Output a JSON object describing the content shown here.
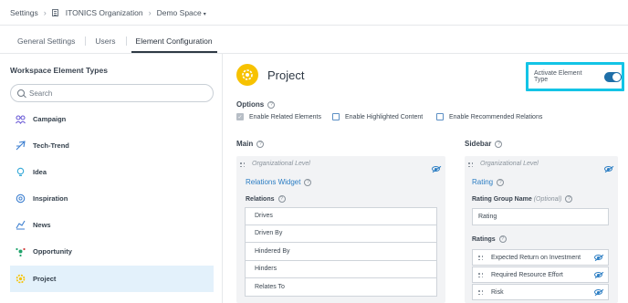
{
  "breadcrumb": {
    "settings": "Settings",
    "separator": "›",
    "organization": "ITONICS Organization",
    "space": "Demo Space",
    "space_caret": "▾"
  },
  "tabs": [
    {
      "label": "General Settings",
      "active": false
    },
    {
      "label": "Users",
      "active": false
    },
    {
      "label": "Element Configuration",
      "active": true
    }
  ],
  "sidebar": {
    "title": "Workspace Element Types",
    "search_placeholder": "Search",
    "items": [
      {
        "label": "Campaign",
        "icon": "campaign-icon",
        "color": "#6b5bd6",
        "active": false
      },
      {
        "label": "Tech-Trend",
        "icon": "tech-trend-icon",
        "color": "#3d7fd0",
        "active": false
      },
      {
        "label": "Idea",
        "icon": "idea-icon",
        "color": "#36a9d8",
        "active": false
      },
      {
        "label": "Inspiration",
        "icon": "inspiration-icon",
        "color": "#3d7fd0",
        "active": false
      },
      {
        "label": "News",
        "icon": "news-icon",
        "color": "#3d7fd0",
        "active": false
      },
      {
        "label": "Opportunity",
        "icon": "opportunity-icon",
        "color": "#20a36b",
        "active": false
      },
      {
        "label": "Project",
        "icon": "project-icon",
        "color": "#f7c200",
        "active": true
      }
    ]
  },
  "element": {
    "title": "Project",
    "accent_color": "#f7c200",
    "activate_label": "Activate Element Type",
    "activate_on": true
  },
  "options": {
    "label": "Options",
    "items": [
      {
        "label": "Enable Related Elements",
        "checked": true
      },
      {
        "label": "Enable Highlighted Content",
        "checked": false
      },
      {
        "label": "Enable Recommended Relations",
        "checked": false
      }
    ]
  },
  "main_section": {
    "label": "Main",
    "org_level": "Organizational Level",
    "widget_title": "Relations Widget",
    "relations_label": "Relations",
    "relations": [
      "Drives",
      "Driven By",
      "Hindered By",
      "Hinders",
      "Relates To"
    ]
  },
  "sidebar_section": {
    "label": "Sidebar",
    "org_level": "Organizational Level",
    "widget_title": "Rating",
    "group_name_label": "Rating Group Name",
    "group_name_optional": "(Optional)",
    "group_name_value": "Rating",
    "ratings_label": "Ratings",
    "ratings": [
      "Expected Return on Investment",
      "Required Resource Effort",
      "Risk"
    ]
  },
  "help_glyph": "?"
}
